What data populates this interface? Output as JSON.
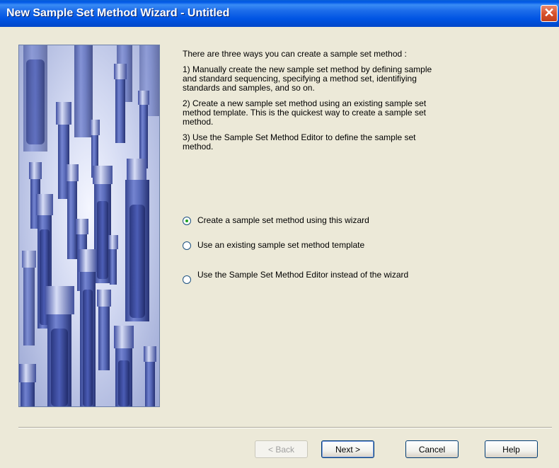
{
  "window": {
    "title": "New Sample Set Method Wizard - Untitled",
    "close_label": "✕"
  },
  "content": {
    "intro": "There are three ways you can create a sample set method :",
    "option1_desc": "1) Manually create the new sample set method by defining sample and standard sequencing, specifying a method set, identifiying standards and samples, and so on.",
    "option2_desc": "2) Create a new sample set method using an existing sample set method template. This is the quickest way to create a sample set method.",
    "option3_desc": "3) Use the Sample Set Method Editor to define the sample set method."
  },
  "options": [
    {
      "label": "Create a sample set method using this wizard",
      "checked": true
    },
    {
      "label": "Use an existing sample set method template",
      "checked": false
    },
    {
      "label": "Use the Sample Set Method Editor instead of the wizard",
      "checked": false
    }
  ],
  "buttons": {
    "back": "< Back",
    "next": "Next >",
    "cancel": "Cancel",
    "help": "Help"
  },
  "colors": {
    "titlebar": "#0054e3",
    "dialog_bg": "#ece9d8",
    "vial": "#4a5fb0"
  },
  "icons": {
    "close": "close-icon"
  }
}
